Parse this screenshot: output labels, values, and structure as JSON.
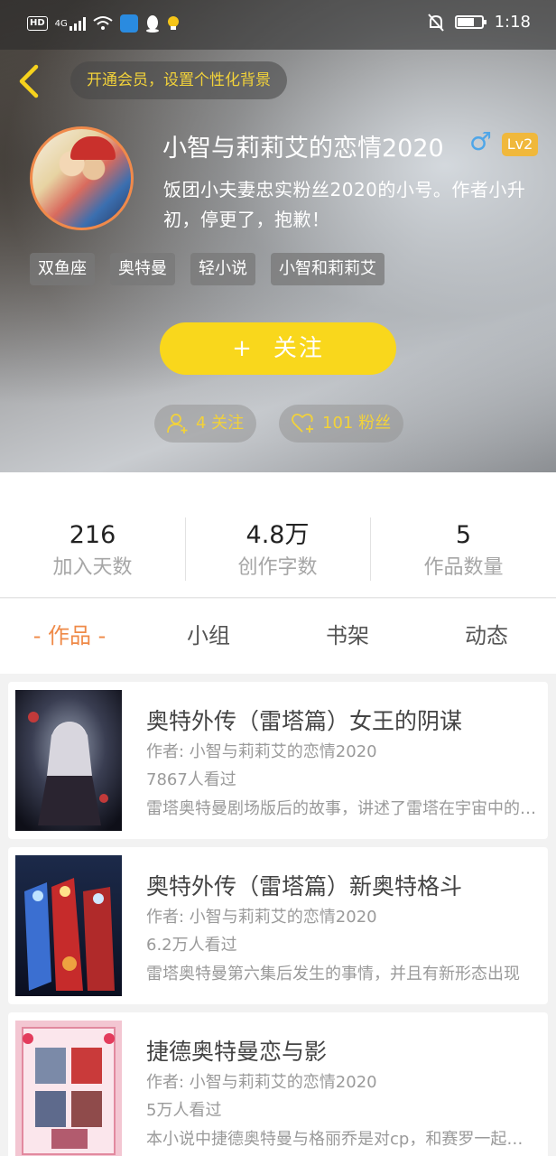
{
  "status_bar": {
    "hd": "HD",
    "net": "4G",
    "time": "1:18"
  },
  "header": {
    "vip_prompt": "开通会员，设置个性化背景"
  },
  "profile": {
    "username": "小智与莉莉艾的恋情2020",
    "gender_symbol": "♂",
    "level": "Lv2",
    "bio": "饭团小夫妻忠实粉丝2020的小号。作者小升初，停更了，抱歉！",
    "tags": [
      "双鱼座",
      "奥特曼",
      "轻小说",
      "小智和莉莉艾"
    ],
    "follow_plus": "+",
    "follow_label": "关注",
    "following_count": "4 关注",
    "followers_count": "101 粉丝"
  },
  "stats": [
    {
      "value": "216",
      "label": "加入天数"
    },
    {
      "value": "4.8万",
      "label": "创作字数"
    },
    {
      "value": "5",
      "label": "作品数量"
    }
  ],
  "tabs": [
    {
      "label": "- 作品 -"
    },
    {
      "label": "小组"
    },
    {
      "label": "书架"
    },
    {
      "label": "动态"
    }
  ],
  "books": [
    {
      "title": "奥特外传（雷塔篇）女王的阴谋",
      "author": "作者: 小智与莉莉艾的恋情2020",
      "views": "7867人看过",
      "desc": "雷塔奥特曼剧场版后的故事，讲述了雷塔在宇宙中的冒险"
    },
    {
      "title": "奥特外传（雷塔篇）新奥特格斗",
      "author": "作者: 小智与莉莉艾的恋情2020",
      "views": "6.2万人看过",
      "desc": "雷塔奥特曼第六集后发生的事情，并且有新形态出现"
    },
    {
      "title": "捷德奥特曼恋与影",
      "author": "作者: 小智与莉莉艾的恋情2020",
      "views": "5万人看过",
      "desc": "本小说中捷德奥特曼与格丽乔是对cp，和赛罗一起冒险"
    }
  ],
  "colors": {
    "accent_yellow": "#f9d71c",
    "tab_active": "#ef8a48",
    "level_badge": "#f0b83c",
    "gender_blue": "#4fa6e8"
  }
}
